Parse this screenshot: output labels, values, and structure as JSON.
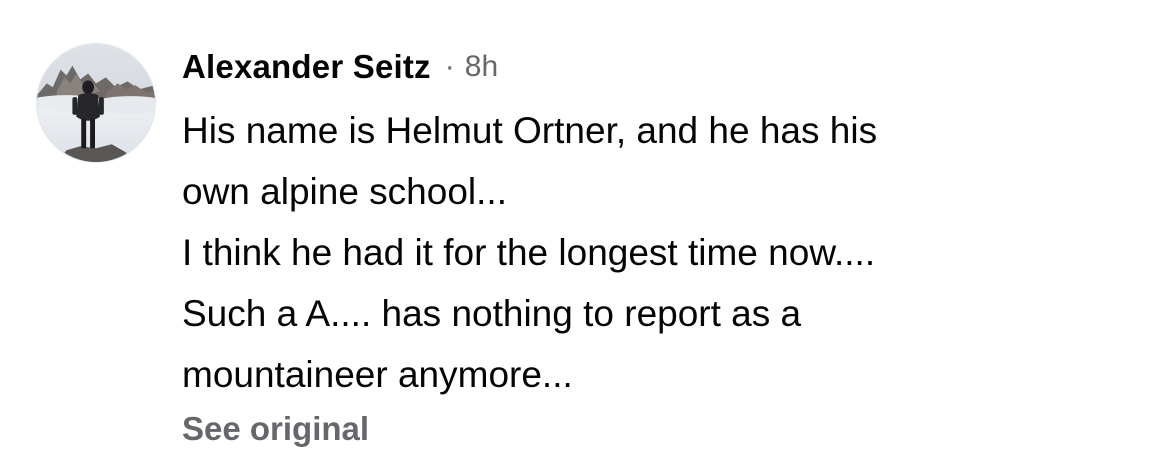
{
  "comment": {
    "author": "Alexander Seitz",
    "separator": "·",
    "timestamp": "8h",
    "avatar_icon": "profile-photo-mountaineer",
    "lines": [
      "His name is Helmut Ortner, and he has his",
      "own alpine school...",
      "I think he had it for the longest time now....",
      "Such a A.... has nothing to report as a",
      "mountaineer anymore..."
    ],
    "see_original_label": "See original"
  },
  "colors": {
    "text_primary": "#050505",
    "text_secondary": "#65676b",
    "background": "#ffffff"
  }
}
